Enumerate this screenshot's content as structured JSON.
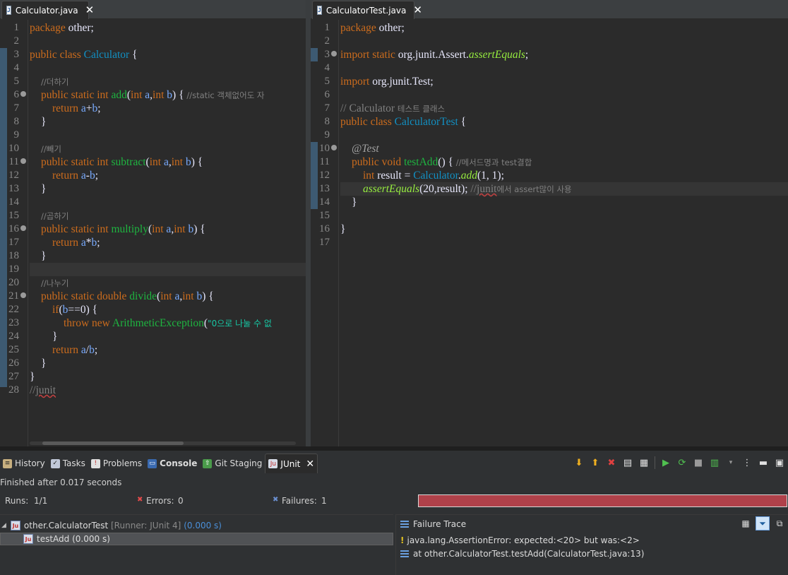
{
  "left_editor": {
    "tab": {
      "icon": "J",
      "label": "Calculator.java"
    },
    "line_numbers": [
      "1",
      "2",
      "3",
      "4",
      "5",
      "6",
      "7",
      "8",
      "9",
      "10",
      "11",
      "12",
      "13",
      "14",
      "15",
      "16",
      "17",
      "18",
      "19",
      "20",
      "21",
      "22",
      "23",
      "24",
      "25",
      "26",
      "27",
      "28"
    ],
    "code": {
      "l1": {
        "kw": "package",
        "id": " other;"
      },
      "l3": {
        "kw": "public class ",
        "cls": "Calculator",
        "rest": " {"
      },
      "l5": {
        "cmt": "//더하기"
      },
      "l6": {
        "kw": "public static int ",
        "name": "add",
        "p1": "(",
        "pk1": "int",
        "pv1": " a",
        "p2": ",",
        "pk2": "int",
        "pv2": " b",
        "p3": ") { ",
        "cmt": "//static 객체없어도 자"
      },
      "l7": {
        "kw": "return ",
        "v1": "a",
        "op": "+",
        "v2": "b",
        "end": ";"
      },
      "l8": {
        "text": "}"
      },
      "l10": {
        "cmt": "//빼기"
      },
      "l11": {
        "kw": "public static int ",
        "name": "subtract",
        "p1": "(",
        "pk1": "int",
        "pv1": " a",
        "p2": ",",
        "pk2": "int",
        "pv2": " b",
        "p3": ") {"
      },
      "l12": {
        "kw": "return ",
        "v1": "a",
        "op": "-",
        "v2": "b",
        "end": ";"
      },
      "l13": {
        "text": "}"
      },
      "l15": {
        "cmt": "//곱하기"
      },
      "l16": {
        "kw": "public static int ",
        "name": "multiply",
        "p1": "(",
        "pk1": "int",
        "pv1": " a",
        "p2": ",",
        "pk2": "int",
        "pv2": " b",
        "p3": ") {"
      },
      "l17": {
        "kw": "return ",
        "v1": "a",
        "op": "*",
        "v2": "b",
        "end": ";"
      },
      "l18": {
        "text": "}"
      },
      "l20": {
        "cmt": "//나누기"
      },
      "l21": {
        "kw": "public static double ",
        "name": "divide",
        "p1": "(",
        "pk1": "int",
        "pv1": " a",
        "p2": ",",
        "pk2": "int",
        "pv2": " b",
        "p3": ") {"
      },
      "l22": {
        "kw": "if",
        "a": "(",
        "v1": "b",
        "b": "==0) {"
      },
      "l23": {
        "kw": "throw new ",
        "cls": "ArithmeticException",
        "a": "(",
        "str": "\"0으로 나눌 수 없"
      },
      "l24": {
        "text": "}"
      },
      "l25": {
        "kw": "return ",
        "v1": "a",
        "op": "/",
        "v2": "b",
        "end": ";"
      },
      "l26": {
        "text": "}"
      },
      "l27": {
        "text": "}"
      },
      "l28": {
        "cmt": "//",
        "sq": "junit"
      }
    }
  },
  "right_editor": {
    "tab": {
      "icon": "J",
      "label": "CalculatorTest.java"
    },
    "line_numbers": [
      "1",
      "2",
      "3",
      "4",
      "5",
      "6",
      "7",
      "8",
      "9",
      "10",
      "11",
      "12",
      "13",
      "14",
      "15",
      "16",
      "17"
    ],
    "code": {
      "l1": {
        "kw": "package",
        "id": " other;"
      },
      "l3": {
        "kw": "import static ",
        "id": "org.junit.Assert.",
        "m": "assertEquals",
        "end": ";"
      },
      "l5": {
        "kw": "import ",
        "id": "org.junit.Test;"
      },
      "l7": {
        "cmt1": "// Calculator ",
        "cmt2": "테스트 클래스"
      },
      "l8": {
        "kw": "public class ",
        "cls": "CalculatorTest",
        "rest": " {"
      },
      "l10": {
        "ann": "@Test"
      },
      "l11": {
        "kw": "public void ",
        "name": "testAdd",
        "rest": "() { ",
        "cmt": "//메서드명과 test결합"
      },
      "l12": {
        "kw": "int ",
        "var": "result",
        "eq": " = ",
        "cls": "Calculator",
        "dot": ".",
        "m": "add",
        "args": "(1, 1);"
      },
      "l13": {
        "m": "assertEquals",
        "a": "(20,",
        "var": "result",
        "b": "); ",
        "cmt1": "//",
        "sq": "junit",
        "cmt2": "에서 assert많이 사용"
      },
      "l14": {
        "text": "}"
      },
      "l16": {
        "text": "}"
      }
    }
  },
  "bottom_view": {
    "tabs": [
      {
        "label": "History"
      },
      {
        "label": "Tasks"
      },
      {
        "label": "Problems"
      },
      {
        "label": "Console"
      },
      {
        "label": "Git Staging"
      },
      {
        "label": "JUnit"
      }
    ],
    "status": "Finished after 0.017 seconds",
    "runs_label": "Runs:",
    "runs_value": "1/1",
    "errors_label": "Errors:",
    "errors_value": "0",
    "failures_label": "Failures:",
    "failures_value": "1",
    "progress_color": "#b0414a",
    "tree": {
      "suite": "other.CalculatorTest",
      "runner": "[Runner: JUnit 4]",
      "time": "(0.000 s)",
      "test": "testAdd (0.000 s)"
    },
    "trace": {
      "title": "Failure Trace",
      "lines": [
        "java.lang.AssertionError: expected:<20> but was:<2>",
        "at other.CalculatorTest.testAdd(CalculatorTest.java:13)"
      ]
    }
  }
}
